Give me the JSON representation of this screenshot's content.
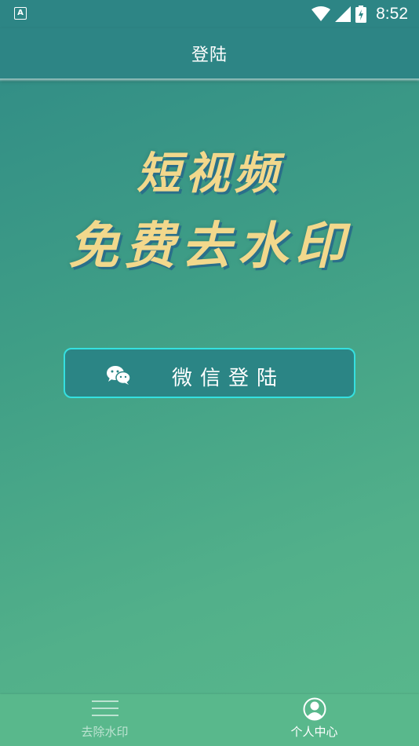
{
  "status_bar": {
    "left_icon": "A",
    "time": "8:52",
    "icons": [
      "wifi-icon",
      "signal-icon",
      "battery-icon"
    ]
  },
  "app_bar": {
    "title": "登陆"
  },
  "headline": {
    "line1": "短视频",
    "line2": "免费去水印"
  },
  "login": {
    "label": "微信登陆",
    "icon": "wechat-icon"
  },
  "bottom_nav": {
    "items": [
      {
        "label": "去除水印",
        "icon": "menu-icon",
        "active": false
      },
      {
        "label": "个人中心",
        "icon": "user-icon",
        "active": true
      }
    ]
  },
  "colors": {
    "bar": "#2d8585",
    "headline": "#f2d88c",
    "button_border": "#35e0e0",
    "nav_bg": "#59b88c"
  }
}
